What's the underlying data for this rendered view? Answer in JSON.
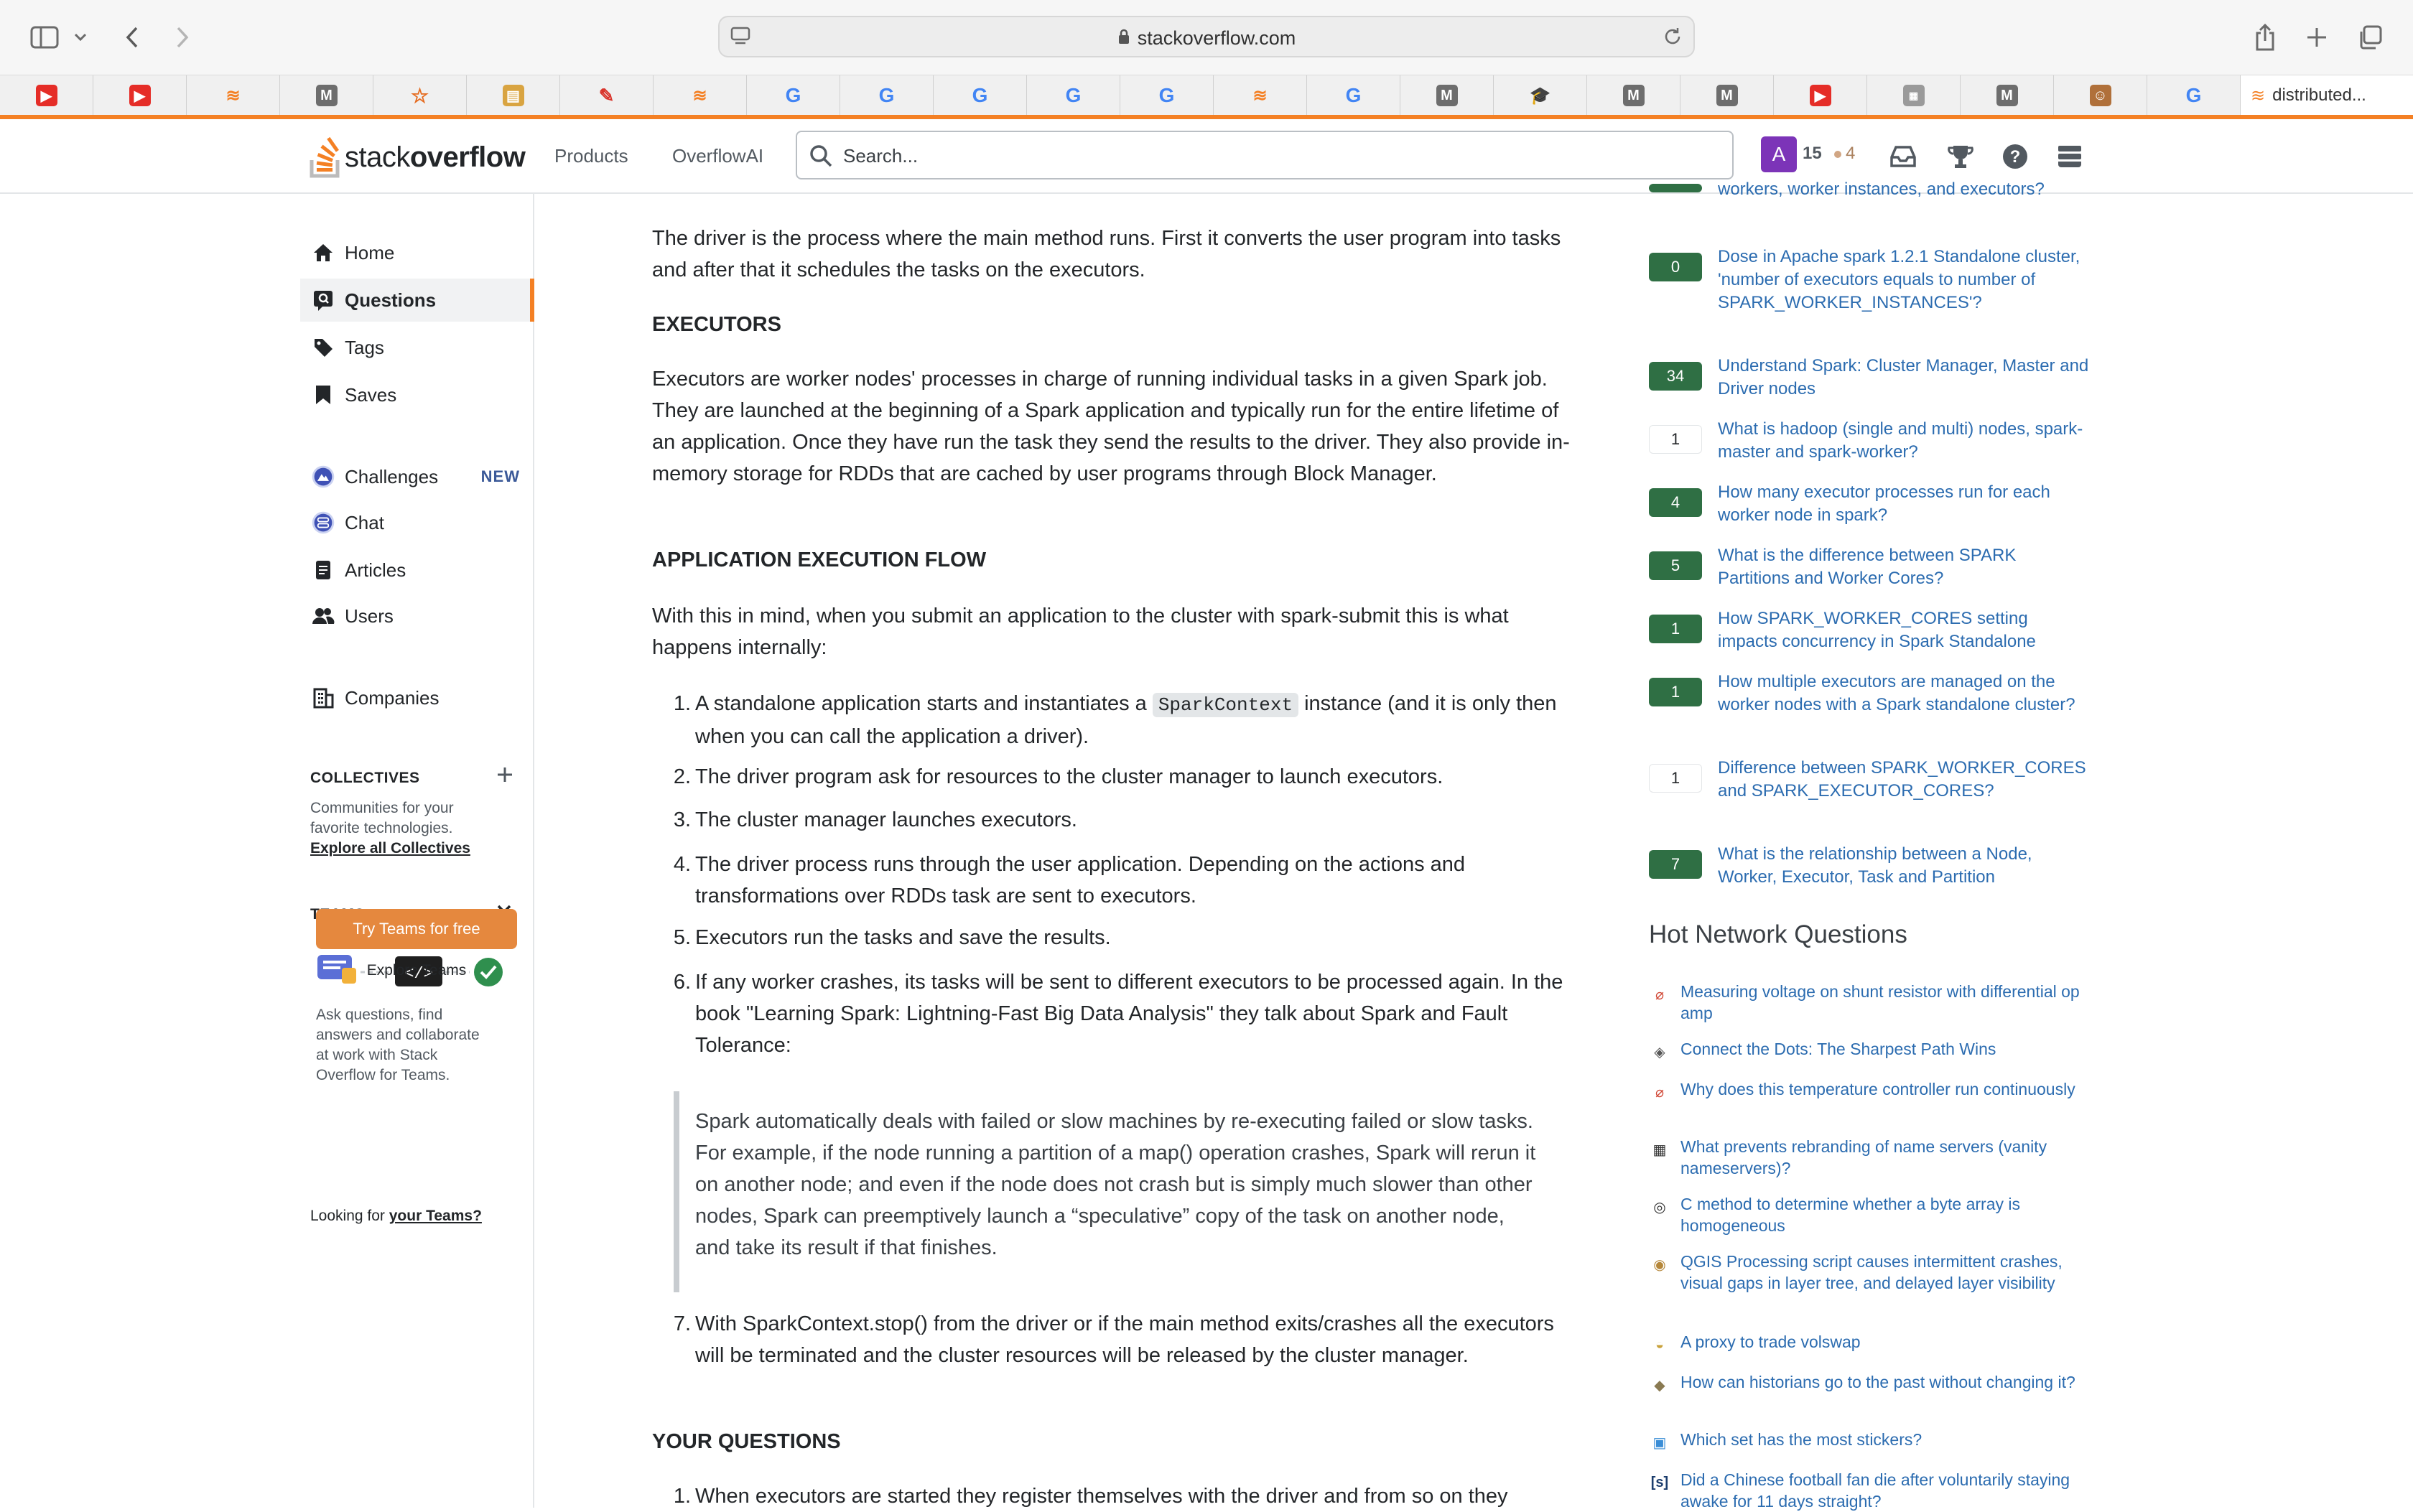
{
  "browser": {
    "url": "stackoverflow.com",
    "last_tab": "distributed..."
  },
  "header": {
    "logo_light": "stack",
    "logo_bold": "overflow",
    "nav_products": "Products",
    "nav_overflowai": "OverflowAI",
    "search_placeholder": "Search...",
    "avatar_letter": "A",
    "reputation": "15",
    "bronze_badges": "4"
  },
  "sidebar": {
    "home": "Home",
    "questions": "Questions",
    "tags": "Tags",
    "saves": "Saves",
    "challenges": "Challenges",
    "challenges_badge": "NEW",
    "chat": "Chat",
    "articles": "Articles",
    "users": "Users",
    "companies": "Companies",
    "collectives_title": "COLLECTIVES",
    "collectives_desc_1": "Communities for your",
    "collectives_desc_2": "favorite technologies.",
    "collectives_link": "Explore all Collectives",
    "teams_title": "TEAMS",
    "teams_desc_1": "Ask questions, find",
    "teams_desc_2": "answers and collaborate",
    "teams_desc_3": "at work with Stack",
    "teams_desc_4": "Overflow for Teams.",
    "try_teams": "Try Teams for free",
    "explore_teams": "Explore Teams",
    "looking_prefix": "Looking for ",
    "looking_link": "your Teams?"
  },
  "answer": {
    "intro": "The driver is the process where the main method runs. First it converts the user program into tasks and after that it schedules the tasks on the executors.",
    "h_executors": "EXECUTORS",
    "executors": "Executors are worker nodes' processes in charge of running individual tasks in a given Spark job. They are launched at the beginning of a Spark application and typically run for the entire lifetime of an application. Once they have run the task they send the results to the driver. They also provide in-memory storage for RDDs that are cached by user programs through Block Manager.",
    "h_flow": "APPLICATION EXECUTION FLOW",
    "flow_intro": "With this in mind, when you submit an application to the cluster with spark-submit this is what happens internally:",
    "step1_a": "A standalone application starts and instantiates a ",
    "step1_code": "SparkContext",
    "step1_b": " instance (and it is only then when you can call the application a driver).",
    "step2": "The driver program ask for resources to the cluster manager to launch executors.",
    "step3": "The cluster manager launches executors.",
    "step4": "The driver process runs through the user application. Depending on the actions and transformations over RDDs task are sent to executors.",
    "step5": "Executors run the tasks and save the results.",
    "step6": "If any worker crashes, its tasks will be sent to different executors to be processed again. In the book \"Learning Spark: Lightning-Fast Big Data Analysis\" they talk about Spark and Fault Tolerance:",
    "quote": "Spark automatically deals with failed or slow machines by re-executing failed or slow tasks. For example, if the node running a partition of a map() operation crashes, Spark will rerun it on another node; and even if the node does not crash but is simply much slower than other nodes, Spark can preemptively launch a “speculative” copy of the task on another node, and take its result if that finishes.",
    "step7": "With SparkContext.stop() from the driver or if the main method exits/crashes all the executors will be terminated and the cluster resources will be released by the cluster manager.",
    "h_questions": "YOUR QUESTIONS",
    "q1": "When executors are started they register themselves with the driver and from so on they"
  },
  "related": [
    {
      "score": "",
      "title": "workers, worker instances, and executors?",
      "accepted": true
    },
    {
      "score": "0",
      "title": "Dose in Apache spark 1.2.1 Standalone cluster, 'number of executors equals to number of SPARK_WORKER_INSTANCES'?",
      "accepted": true
    },
    {
      "score": "34",
      "title": "Understand Spark: Cluster Manager, Master and Driver nodes",
      "accepted": true
    },
    {
      "score": "1",
      "title": "What is hadoop (single and multi) nodes, spark-master and spark-worker?",
      "accepted": false
    },
    {
      "score": "4",
      "title": "How many executor processes run for each worker node in spark?",
      "accepted": true
    },
    {
      "score": "5",
      "title": "What is the difference between SPARK Partitions and Worker Cores?",
      "accepted": true
    },
    {
      "score": "1",
      "title": "How SPARK_WORKER_CORES setting impacts concurrency in Spark Standalone",
      "accepted": true
    },
    {
      "score": "1",
      "title": "How multiple executors are managed on the worker nodes with a Spark standalone cluster?",
      "accepted": true
    },
    {
      "score": "1",
      "title": "Difference between SPARK_WORKER_CORES and SPARK_EXECUTOR_CORES?",
      "accepted": false
    },
    {
      "score": "7",
      "title": "What is the relationship between a Node, Worker, Executor, Task and Partition",
      "accepted": true
    }
  ],
  "hot_network": {
    "title": "Hot Network Questions",
    "items": [
      {
        "icon": "electronics-icon",
        "title": "Measuring voltage on shunt resistor with differential op amp"
      },
      {
        "icon": "puzzling-icon",
        "title": "Connect the Dots: The Sharpest Path Wins"
      },
      {
        "icon": "electronics-icon",
        "title": "Why does this temperature controller run continuously"
      },
      {
        "icon": "serverfault-icon",
        "title": "What prevents rebranding of name servers (vanity nameservers)?"
      },
      {
        "icon": "codereview-icon",
        "title": "C method to determine whether a byte array is homogeneous"
      },
      {
        "icon": "gis-icon",
        "title": "QGIS Processing script causes intermittent crashes, visual gaps in layer tree, and delayed layer visibility"
      },
      {
        "icon": "money-icon",
        "title": "A proxy to trade volswap"
      },
      {
        "icon": "history-icon",
        "title": "How can historians go to the past without changing it?"
      },
      {
        "icon": "lego-icon",
        "title": "Which set has the most stickers?"
      },
      {
        "icon": "skeptics-icon",
        "title": "Did a Chinese football fan die after voluntarily staying awake for 11 days straight?"
      }
    ]
  },
  "colors": {
    "brand_orange": "#f48024",
    "link_blue": "#2c6cb0",
    "accepted_green": "#2f6f44"
  }
}
